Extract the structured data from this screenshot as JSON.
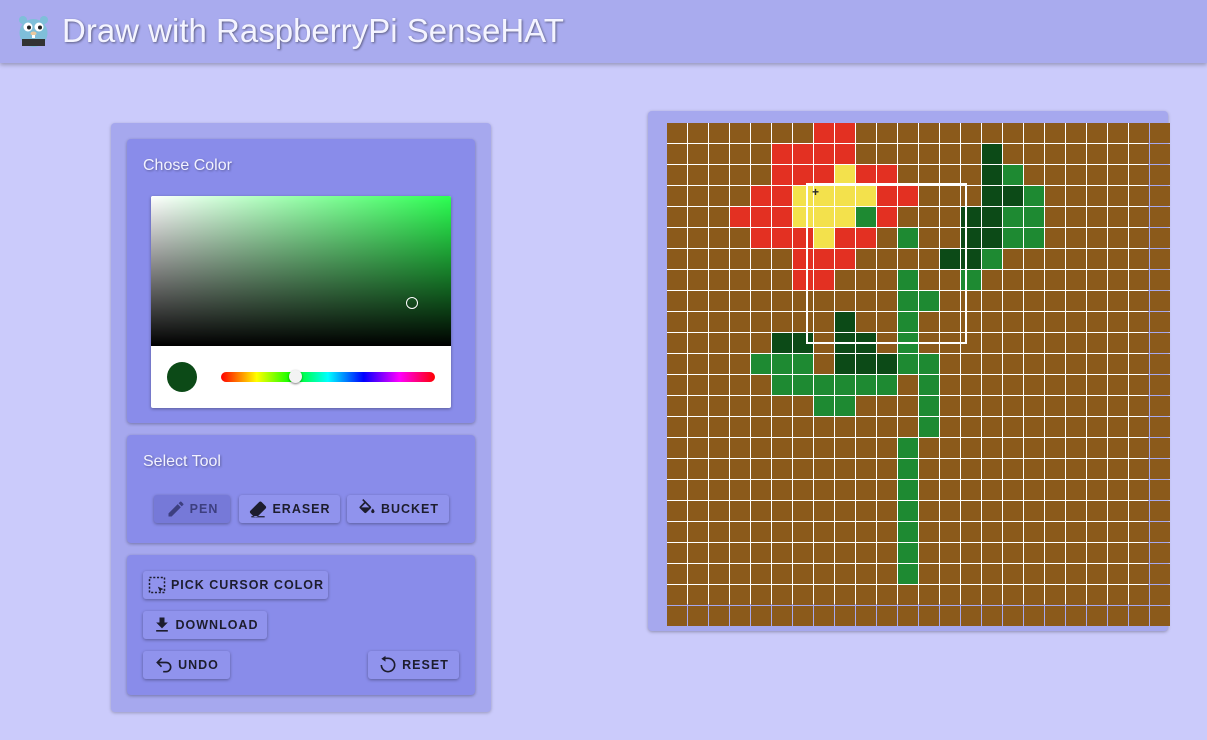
{
  "header": {
    "title": "Draw with RaspberryPi SenseHAT",
    "logo_icon": "gopher-logo-icon"
  },
  "color_card": {
    "title": "Chose Color",
    "selected_color": "#0c4a17",
    "hue_color": "#2cff52"
  },
  "tool_card": {
    "title": "Select Tool",
    "tools": [
      {
        "label": "PEN",
        "icon": "pen-icon",
        "active": true
      },
      {
        "label": "ERASER",
        "icon": "eraser-icon",
        "active": false
      },
      {
        "label": "BUCKET",
        "icon": "bucket-icon",
        "active": false
      }
    ]
  },
  "actions": {
    "pick_cursor": "PICK CURSOR COLOR",
    "download": "DOWNLOAD",
    "undo": "UNDO",
    "reset": "RESET"
  },
  "canvas": {
    "size": 24,
    "palette": {
      "B": "#8b5a1b",
      "R": "#e33022",
      "Y": "#f3e14c",
      "D": "#0c4a17",
      "G": "#1e8a32"
    },
    "rows": [
      "BBBBBBBRRBBBBBBBBBBBBBBB",
      "BBBBBRRRRBBBBBBDBBBBBBBB",
      "BBBBBRRRYRRBBBBDGBBBBBBB",
      "BBBBRRYYYYRRBBBDDGBBBBBB",
      "BBBRRRYYYGRBBBDDGGBBBBBB",
      "BBBBRRRYRRBGBBDDGGBBBBBB",
      "BBBBBBRRRBBBBDDGBBBBBBBB",
      "BBBBBBRRBBBGBBGBBBBBBBBB",
      "BBBBBBBBBBBGGBBBBBBBBBBB",
      "BBBBBBBBDBBGBBBBBBBBBBBB",
      "BBBBBDDBDDBGBBBBBBBBBBBB",
      "BBBBGGGBDDDGGBBBBBBBBBBB",
      "BBBBBGGGGGGBGBBBBBBBBBBB",
      "BBBBBBBGGBBBGBBBBBBBBBBB",
      "BBBBBBBBBBBBGBBBBBBBBBBB",
      "BBBBBBBBBBBGBBBBBBBBBBBB",
      "BBBBBBBBBBBGBBBBBBBBBBBB",
      "BBBBBBBBBBBGBBBBBBBBBBBB",
      "BBBBBBBBBBBGBBBBBBBBBBBB",
      "BBBBBBBBBBBGBBBBBBBBBBBB",
      "BBBBBBBBBBBGBBBBBBBBBBBB",
      "BBBBBBBBBBBGBBBBBBBBBBBB",
      "BBBBBBBBBBBBBBBBBBBBBBBB",
      "BBBBBBBBBBBBBBBBBBBBBBBB"
    ],
    "cursor_color": "#ffffff"
  }
}
